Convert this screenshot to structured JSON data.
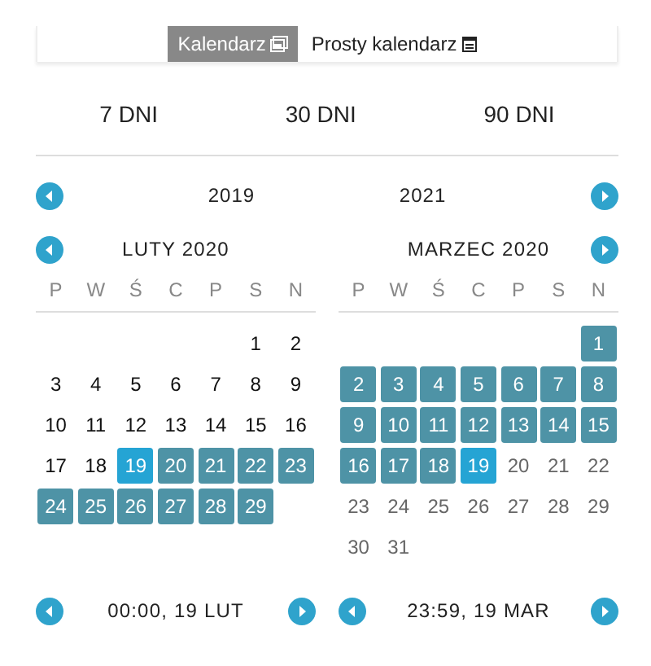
{
  "tabs": [
    {
      "label": "Kalendarz",
      "selected": true
    },
    {
      "label": "Prosty kalendarz",
      "selected": false
    }
  ],
  "presets": [
    "7 DNI",
    "30 DNI",
    "90 DNI"
  ],
  "years": {
    "previous": "2019",
    "next": "2021"
  },
  "months": [
    {
      "title": "LUTY 2020",
      "weekdays": [
        "P",
        "W",
        "Ś",
        "C",
        "P",
        "S",
        "N"
      ],
      "weeks": [
        [
          {
            "d": "1",
            "kind": "plain"
          },
          {
            "d": "2",
            "kind": "plain"
          }
        ],
        [
          {
            "d": "3",
            "kind": "plain"
          },
          {
            "d": "4",
            "kind": "plain"
          },
          {
            "d": "5",
            "kind": "plain"
          },
          {
            "d": "6",
            "kind": "plain"
          },
          {
            "d": "7",
            "kind": "plain"
          },
          {
            "d": "8",
            "kind": "plain"
          },
          {
            "d": "9",
            "kind": "plain"
          }
        ],
        [
          {
            "d": "10",
            "kind": "plain"
          },
          {
            "d": "11",
            "kind": "plain"
          },
          {
            "d": "12",
            "kind": "plain"
          },
          {
            "d": "13",
            "kind": "plain"
          },
          {
            "d": "14",
            "kind": "plain"
          },
          {
            "d": "15",
            "kind": "plain"
          },
          {
            "d": "16",
            "kind": "plain"
          }
        ],
        [
          {
            "d": "17",
            "kind": "plain"
          },
          {
            "d": "18",
            "kind": "plain"
          },
          {
            "d": "19",
            "kind": "endpoint"
          },
          {
            "d": "20",
            "kind": "range"
          },
          {
            "d": "21",
            "kind": "range"
          },
          {
            "d": "22",
            "kind": "range"
          },
          {
            "d": "23",
            "kind": "range"
          }
        ],
        [
          {
            "d": "24",
            "kind": "range"
          },
          {
            "d": "25",
            "kind": "range"
          },
          {
            "d": "26",
            "kind": "range"
          },
          {
            "d": "27",
            "kind": "range"
          },
          {
            "d": "28",
            "kind": "range"
          },
          {
            "d": "29",
            "kind": "range"
          }
        ]
      ]
    },
    {
      "title": "MARZEC 2020",
      "weekdays": [
        "P",
        "W",
        "Ś",
        "C",
        "P",
        "S",
        "N"
      ],
      "weeks": [
        [
          {
            "d": "1",
            "kind": "range"
          }
        ],
        [
          {
            "d": "2",
            "kind": "range"
          },
          {
            "d": "3",
            "kind": "range"
          },
          {
            "d": "4",
            "kind": "range"
          },
          {
            "d": "5",
            "kind": "range"
          },
          {
            "d": "6",
            "kind": "range"
          },
          {
            "d": "7",
            "kind": "range"
          },
          {
            "d": "8",
            "kind": "range"
          }
        ],
        [
          {
            "d": "9",
            "kind": "range"
          },
          {
            "d": "10",
            "kind": "range"
          },
          {
            "d": "11",
            "kind": "range"
          },
          {
            "d": "12",
            "kind": "range"
          },
          {
            "d": "13",
            "kind": "range"
          },
          {
            "d": "14",
            "kind": "range"
          },
          {
            "d": "15",
            "kind": "range"
          }
        ],
        [
          {
            "d": "16",
            "kind": "range"
          },
          {
            "d": "17",
            "kind": "range"
          },
          {
            "d": "18",
            "kind": "range"
          },
          {
            "d": "19",
            "kind": "endpoint"
          },
          {
            "d": "20",
            "kind": "muted"
          },
          {
            "d": "21",
            "kind": "muted"
          },
          {
            "d": "22",
            "kind": "muted"
          }
        ],
        [
          {
            "d": "23",
            "kind": "muted"
          },
          {
            "d": "24",
            "kind": "muted"
          },
          {
            "d": "25",
            "kind": "muted"
          },
          {
            "d": "26",
            "kind": "muted"
          },
          {
            "d": "27",
            "kind": "muted"
          },
          {
            "d": "28",
            "kind": "muted"
          },
          {
            "d": "29",
            "kind": "muted"
          }
        ],
        [
          {
            "d": "30",
            "kind": "muted"
          },
          {
            "d": "31",
            "kind": "muted"
          }
        ]
      ]
    }
  ],
  "times": [
    {
      "value": "00:00, 19 LUT"
    },
    {
      "value": "23:59, 19 MAR"
    }
  ]
}
